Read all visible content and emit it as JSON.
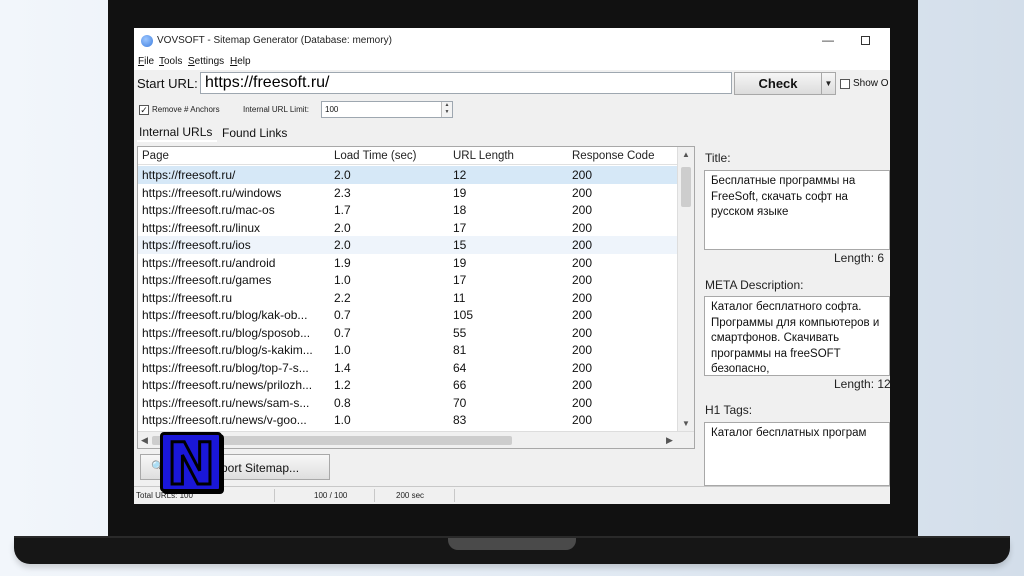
{
  "window": {
    "title": "VOVSOFT - Sitemap Generator (Database: memory)"
  },
  "menu": [
    "File",
    "Tools",
    "Settings",
    "Help"
  ],
  "toolbar": {
    "start_url_label": "Start URL:",
    "start_url_value": "https://freesoft.ru/",
    "check_label": "Check",
    "show_label": "Show O"
  },
  "options": {
    "remove_anchors_label": "Remove # Anchors",
    "remove_anchors_checked": true,
    "limit_label": "Internal URL Limit:",
    "limit_value": "100"
  },
  "tabs": [
    "Internal URLs",
    "Found Links"
  ],
  "grid": {
    "columns": [
      "Page",
      "Load Time (sec)",
      "URL Length",
      "Response Code"
    ],
    "rows": [
      [
        "https://freesoft.ru/",
        "2.0",
        "12",
        "200"
      ],
      [
        "https://freesoft.ru/windows",
        "2.3",
        "19",
        "200"
      ],
      [
        "https://freesoft.ru/mac-os",
        "1.7",
        "18",
        "200"
      ],
      [
        "https://freesoft.ru/linux",
        "2.0",
        "17",
        "200"
      ],
      [
        "https://freesoft.ru/ios",
        "2.0",
        "15",
        "200"
      ],
      [
        "https://freesoft.ru/android",
        "1.9",
        "19",
        "200"
      ],
      [
        "https://freesoft.ru/games",
        "1.0",
        "17",
        "200"
      ],
      [
        "https://freesoft.ru",
        "2.2",
        "11",
        "200"
      ],
      [
        "https://freesoft.ru/blog/kak-ob...",
        "0.7",
        "105",
        "200"
      ],
      [
        "https://freesoft.ru/blog/sposob...",
        "0.7",
        "55",
        "200"
      ],
      [
        "https://freesoft.ru/blog/s-kakim...",
        "1.0",
        "81",
        "200"
      ],
      [
        "https://freesoft.ru/blog/top-7-s...",
        "1.4",
        "64",
        "200"
      ],
      [
        "https://freesoft.ru/news/prilozh...",
        "1.2",
        "66",
        "200"
      ],
      [
        "https://freesoft.ru/news/sam-s...",
        "0.8",
        "70",
        "200"
      ],
      [
        "https://freesoft.ru/news/v-goo...",
        "1.0",
        "83",
        "200"
      ]
    ]
  },
  "export": {
    "label": "port Sitemap...",
    "icon": "search-icon"
  },
  "status": {
    "total": "Total URLs: 100",
    "progress": "100 / 100",
    "time": "200 sec"
  },
  "details": {
    "title_label": "Title:",
    "title_value": "Бесплатные программы на FreeSoft, скачать софт на русском языке",
    "title_length": "Length: 6",
    "meta_label": "META Description:",
    "meta_value": "Каталог бесплатного софта. Программы для компьютеров и смартфонов. Скачивать программы на freeSOFT безопасно,",
    "meta_length": "Length: 12",
    "h1_label": "H1 Tags:",
    "h1_value": "Каталог бесплатных програм"
  },
  "overlay": {
    "logo_letter": "N",
    "logo_color": "#1a17d8"
  }
}
